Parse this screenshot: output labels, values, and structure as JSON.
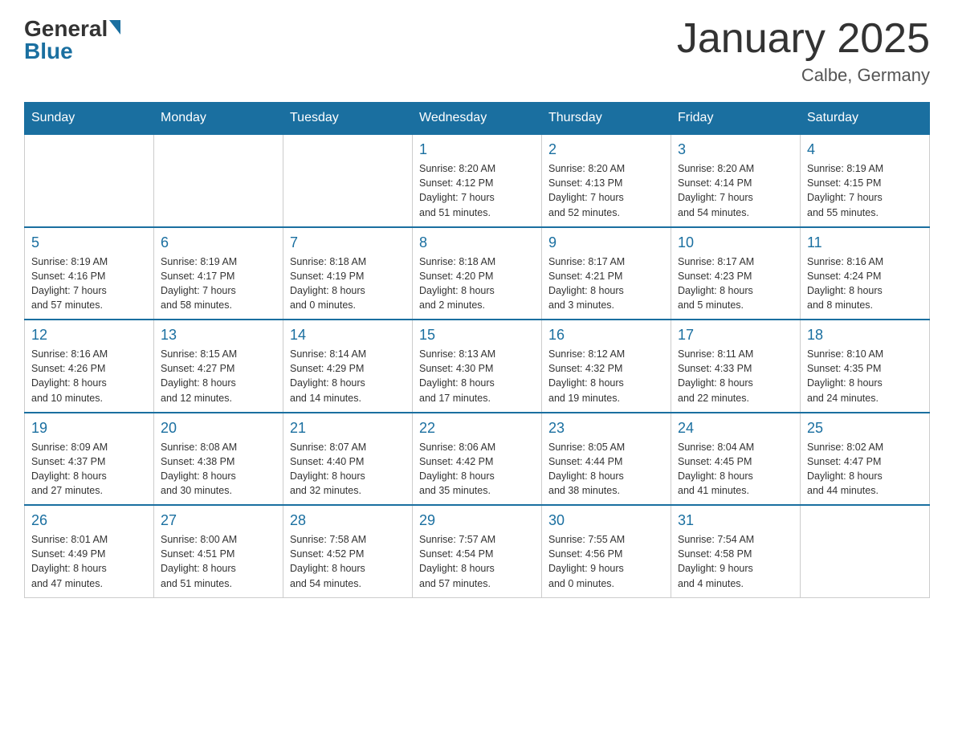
{
  "header": {
    "logo_general": "General",
    "logo_blue": "Blue",
    "title": "January 2025",
    "subtitle": "Calbe, Germany"
  },
  "days_of_week": [
    "Sunday",
    "Monday",
    "Tuesday",
    "Wednesday",
    "Thursday",
    "Friday",
    "Saturday"
  ],
  "weeks": [
    [
      {
        "day": "",
        "info": ""
      },
      {
        "day": "",
        "info": ""
      },
      {
        "day": "",
        "info": ""
      },
      {
        "day": "1",
        "info": "Sunrise: 8:20 AM\nSunset: 4:12 PM\nDaylight: 7 hours\nand 51 minutes."
      },
      {
        "day": "2",
        "info": "Sunrise: 8:20 AM\nSunset: 4:13 PM\nDaylight: 7 hours\nand 52 minutes."
      },
      {
        "day": "3",
        "info": "Sunrise: 8:20 AM\nSunset: 4:14 PM\nDaylight: 7 hours\nand 54 minutes."
      },
      {
        "day": "4",
        "info": "Sunrise: 8:19 AM\nSunset: 4:15 PM\nDaylight: 7 hours\nand 55 minutes."
      }
    ],
    [
      {
        "day": "5",
        "info": "Sunrise: 8:19 AM\nSunset: 4:16 PM\nDaylight: 7 hours\nand 57 minutes."
      },
      {
        "day": "6",
        "info": "Sunrise: 8:19 AM\nSunset: 4:17 PM\nDaylight: 7 hours\nand 58 minutes."
      },
      {
        "day": "7",
        "info": "Sunrise: 8:18 AM\nSunset: 4:19 PM\nDaylight: 8 hours\nand 0 minutes."
      },
      {
        "day": "8",
        "info": "Sunrise: 8:18 AM\nSunset: 4:20 PM\nDaylight: 8 hours\nand 2 minutes."
      },
      {
        "day": "9",
        "info": "Sunrise: 8:17 AM\nSunset: 4:21 PM\nDaylight: 8 hours\nand 3 minutes."
      },
      {
        "day": "10",
        "info": "Sunrise: 8:17 AM\nSunset: 4:23 PM\nDaylight: 8 hours\nand 5 minutes."
      },
      {
        "day": "11",
        "info": "Sunrise: 8:16 AM\nSunset: 4:24 PM\nDaylight: 8 hours\nand 8 minutes."
      }
    ],
    [
      {
        "day": "12",
        "info": "Sunrise: 8:16 AM\nSunset: 4:26 PM\nDaylight: 8 hours\nand 10 minutes."
      },
      {
        "day": "13",
        "info": "Sunrise: 8:15 AM\nSunset: 4:27 PM\nDaylight: 8 hours\nand 12 minutes."
      },
      {
        "day": "14",
        "info": "Sunrise: 8:14 AM\nSunset: 4:29 PM\nDaylight: 8 hours\nand 14 minutes."
      },
      {
        "day": "15",
        "info": "Sunrise: 8:13 AM\nSunset: 4:30 PM\nDaylight: 8 hours\nand 17 minutes."
      },
      {
        "day": "16",
        "info": "Sunrise: 8:12 AM\nSunset: 4:32 PM\nDaylight: 8 hours\nand 19 minutes."
      },
      {
        "day": "17",
        "info": "Sunrise: 8:11 AM\nSunset: 4:33 PM\nDaylight: 8 hours\nand 22 minutes."
      },
      {
        "day": "18",
        "info": "Sunrise: 8:10 AM\nSunset: 4:35 PM\nDaylight: 8 hours\nand 24 minutes."
      }
    ],
    [
      {
        "day": "19",
        "info": "Sunrise: 8:09 AM\nSunset: 4:37 PM\nDaylight: 8 hours\nand 27 minutes."
      },
      {
        "day": "20",
        "info": "Sunrise: 8:08 AM\nSunset: 4:38 PM\nDaylight: 8 hours\nand 30 minutes."
      },
      {
        "day": "21",
        "info": "Sunrise: 8:07 AM\nSunset: 4:40 PM\nDaylight: 8 hours\nand 32 minutes."
      },
      {
        "day": "22",
        "info": "Sunrise: 8:06 AM\nSunset: 4:42 PM\nDaylight: 8 hours\nand 35 minutes."
      },
      {
        "day": "23",
        "info": "Sunrise: 8:05 AM\nSunset: 4:44 PM\nDaylight: 8 hours\nand 38 minutes."
      },
      {
        "day": "24",
        "info": "Sunrise: 8:04 AM\nSunset: 4:45 PM\nDaylight: 8 hours\nand 41 minutes."
      },
      {
        "day": "25",
        "info": "Sunrise: 8:02 AM\nSunset: 4:47 PM\nDaylight: 8 hours\nand 44 minutes."
      }
    ],
    [
      {
        "day": "26",
        "info": "Sunrise: 8:01 AM\nSunset: 4:49 PM\nDaylight: 8 hours\nand 47 minutes."
      },
      {
        "day": "27",
        "info": "Sunrise: 8:00 AM\nSunset: 4:51 PM\nDaylight: 8 hours\nand 51 minutes."
      },
      {
        "day": "28",
        "info": "Sunrise: 7:58 AM\nSunset: 4:52 PM\nDaylight: 8 hours\nand 54 minutes."
      },
      {
        "day": "29",
        "info": "Sunrise: 7:57 AM\nSunset: 4:54 PM\nDaylight: 8 hours\nand 57 minutes."
      },
      {
        "day": "30",
        "info": "Sunrise: 7:55 AM\nSunset: 4:56 PM\nDaylight: 9 hours\nand 0 minutes."
      },
      {
        "day": "31",
        "info": "Sunrise: 7:54 AM\nSunset: 4:58 PM\nDaylight: 9 hours\nand 4 minutes."
      },
      {
        "day": "",
        "info": ""
      }
    ]
  ]
}
